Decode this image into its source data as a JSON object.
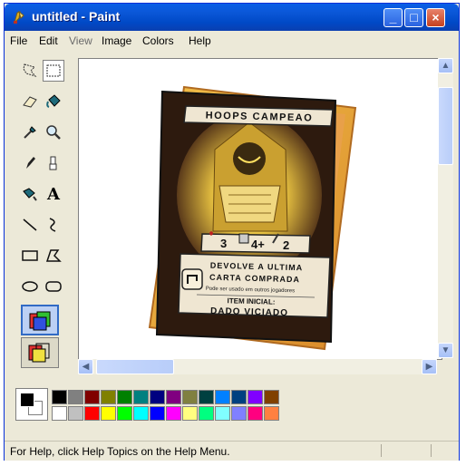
{
  "window": {
    "title": "untitled - Paint",
    "buttons": {
      "minimize": "_",
      "maximize": "□",
      "close": "×"
    }
  },
  "menu": [
    "File",
    "Edit",
    "View",
    "Image",
    "Colors",
    "Help"
  ],
  "tools": [
    {
      "name": "free-form-select-icon",
      "selected": false
    },
    {
      "name": "select-icon",
      "selected": true
    },
    {
      "name": "eraser-icon",
      "selected": false
    },
    {
      "name": "fill-with-color-icon",
      "selected": false
    },
    {
      "name": "pick-color-icon",
      "selected": false
    },
    {
      "name": "magnifier-icon",
      "selected": false
    },
    {
      "name": "pencil-icon",
      "selected": false
    },
    {
      "name": "brush-icon",
      "selected": false
    },
    {
      "name": "airbrush-icon",
      "selected": false
    },
    {
      "name": "text-icon",
      "selected": false
    },
    {
      "name": "line-icon",
      "selected": false
    },
    {
      "name": "curve-icon",
      "selected": false
    },
    {
      "name": "rectangle-icon",
      "selected": false
    },
    {
      "name": "polygon-icon",
      "selected": false
    },
    {
      "name": "ellipse-icon",
      "selected": false
    },
    {
      "name": "rounded-rectangle-icon",
      "selected": false
    }
  ],
  "text_tool_glyph": "A",
  "card": {
    "title": "HOOPS CAMPEAO",
    "stats": {
      "hearts": "3",
      "dice": "4+",
      "swords": "2"
    },
    "ability_line1": "DEVOLVE A ULTIMA",
    "ability_line2": "CARTA COMPRADA",
    "note": "Pode ser usado em outros jogadores",
    "item_label": "ITEM INICIAL:",
    "item_name": "DADO VICIADO"
  },
  "palette": {
    "foreground": "#000000",
    "background": "#ffffff",
    "row1": [
      "#000000",
      "#808080",
      "#800000",
      "#808000",
      "#008000",
      "#008080",
      "#000080",
      "#800080",
      "#808040",
      "#004040",
      "#0080ff",
      "#004080",
      "#8000ff",
      "#804000"
    ],
    "row2": [
      "#ffffff",
      "#c0c0c0",
      "#ff0000",
      "#ffff00",
      "#00ff00",
      "#00ffff",
      "#0000ff",
      "#ff00ff",
      "#ffff80",
      "#00ff80",
      "#80ffff",
      "#8080ff",
      "#ff0080",
      "#ff8040"
    ]
  },
  "status": {
    "text": "For Help, click Help Topics on the Help Menu."
  },
  "colors": {
    "title_bar": "#0a5fe6",
    "window_bg": "#ece9d8",
    "canvas_bg": "#ffffff"
  }
}
